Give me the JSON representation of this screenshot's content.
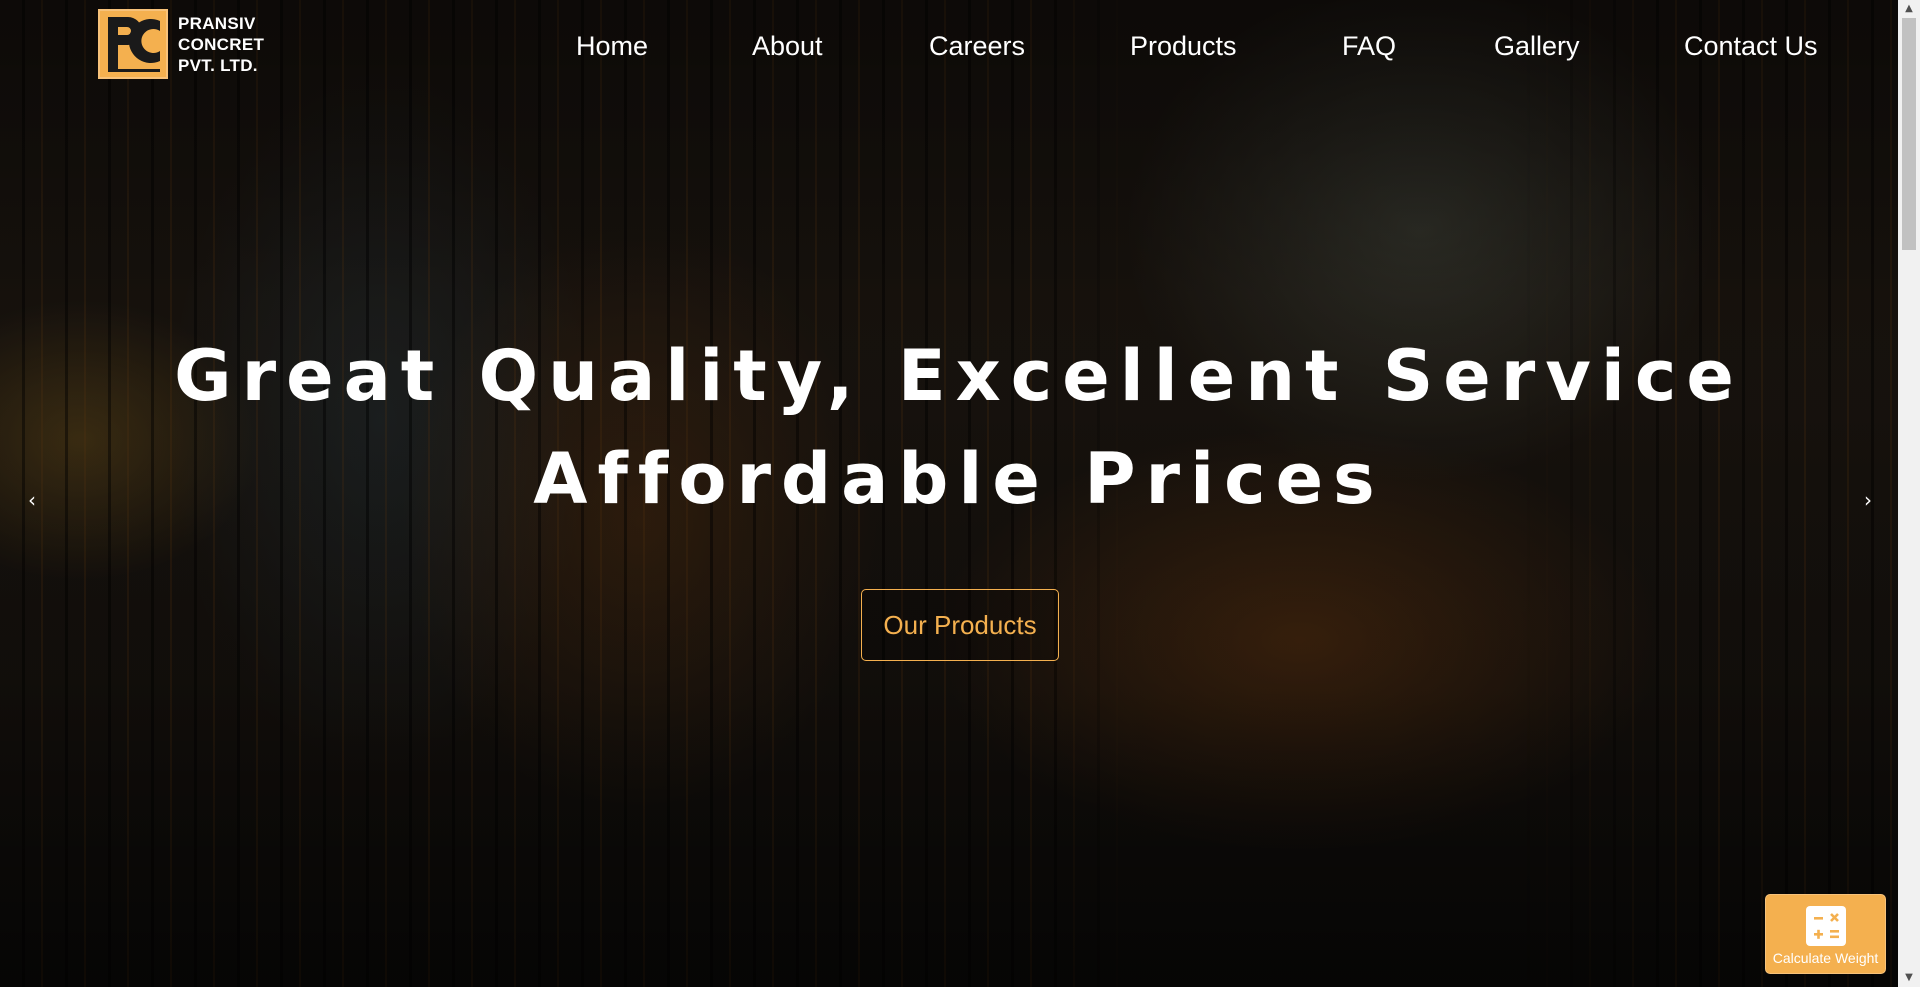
{
  "brand": {
    "name_lines": [
      "PRANSIV",
      "CONCRET",
      "PVT. LTD."
    ],
    "logo_icon": "pc-monogram-logo",
    "accent_color": "#f4b04f"
  },
  "nav": {
    "items": [
      {
        "label": "Home"
      },
      {
        "label": "About"
      },
      {
        "label": "Careers"
      },
      {
        "label": "Products"
      },
      {
        "label": "FAQ"
      },
      {
        "label": "Gallery"
      },
      {
        "label": "Contact Us"
      }
    ]
  },
  "hero": {
    "title_lines": [
      "Great Quality, Excellent Service",
      "Affordable Prices"
    ],
    "cta_label": "Our Products",
    "prev_icon": "chevron-left-icon",
    "next_icon": "chevron-right-icon",
    "prev_glyph": "‹",
    "next_glyph": "›"
  },
  "widget": {
    "label": "Calculate Weight",
    "icon": "calculator-icon"
  },
  "scrollbar": {
    "up_glyph": "▲",
    "down_glyph": "▼"
  }
}
